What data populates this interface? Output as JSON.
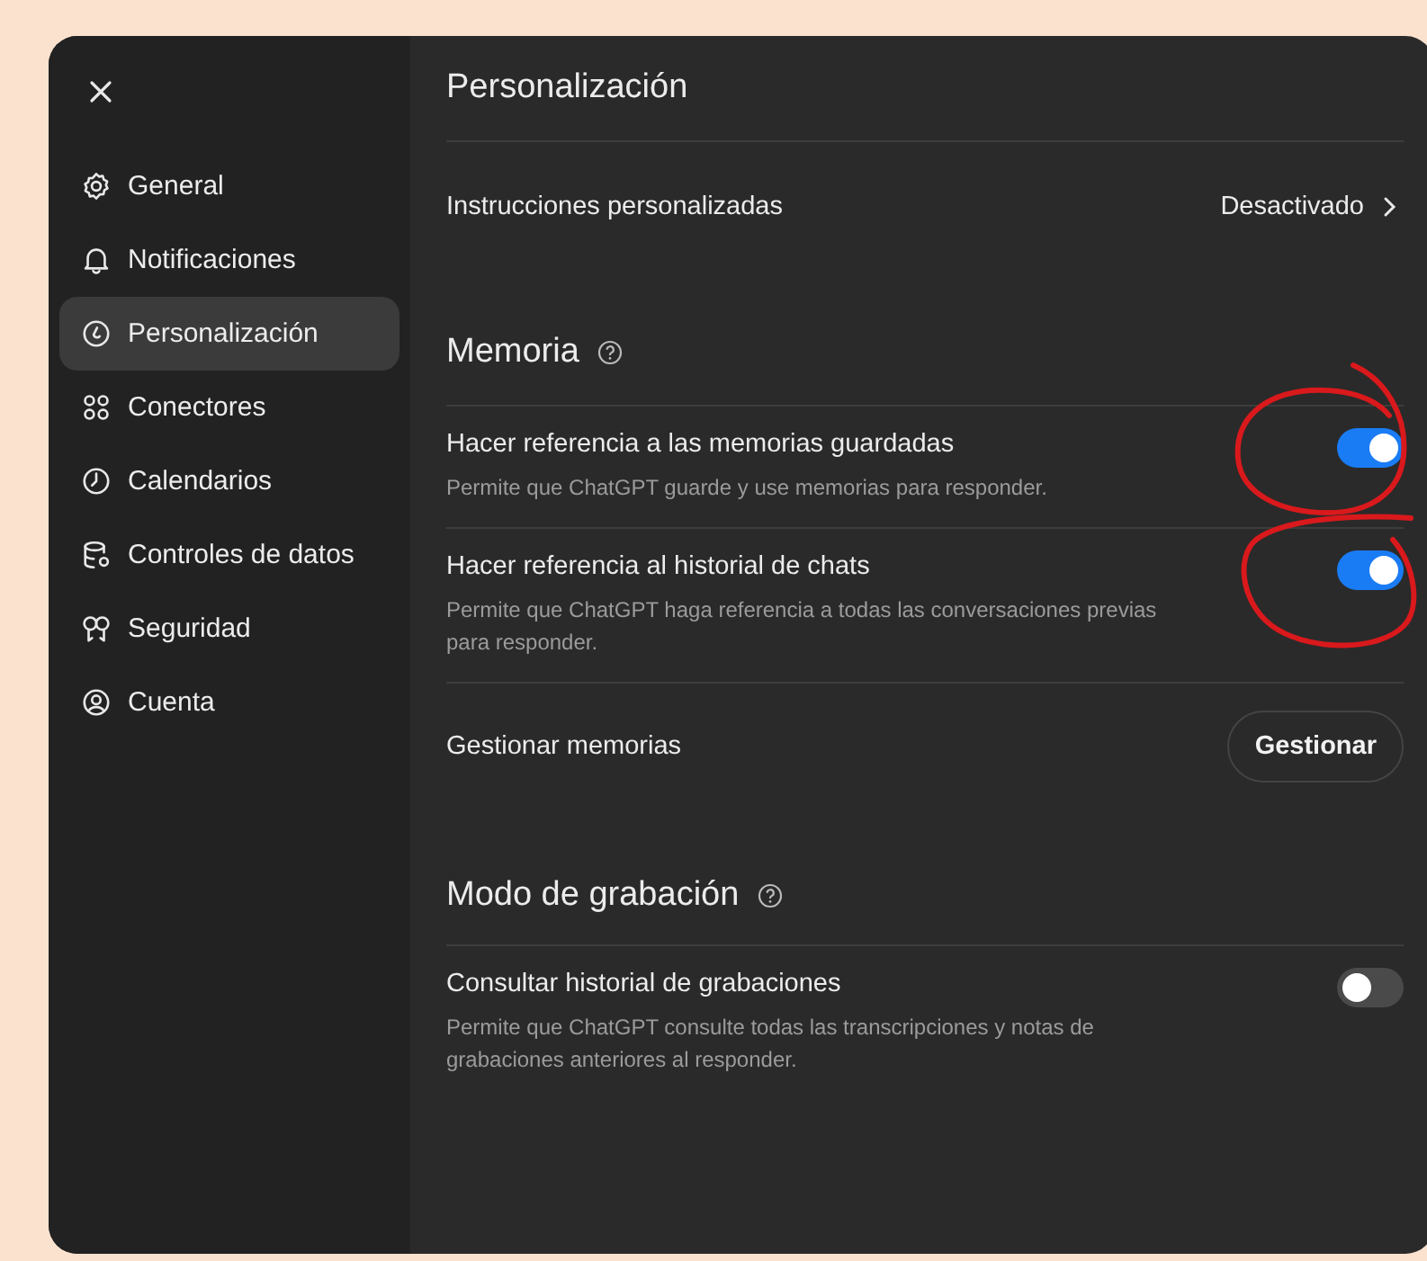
{
  "sidebar": {
    "items": [
      {
        "label": "General",
        "selected": false
      },
      {
        "label": "Notificaciones",
        "selected": false
      },
      {
        "label": "Personalización",
        "selected": true
      },
      {
        "label": "Conectores",
        "selected": false
      },
      {
        "label": "Calendarios",
        "selected": false
      },
      {
        "label": "Controles de datos",
        "selected": false
      },
      {
        "label": "Seguridad",
        "selected": false
      },
      {
        "label": "Cuenta",
        "selected": false
      }
    ]
  },
  "page": {
    "title": "Personalización",
    "rows": [
      {
        "kind": "link",
        "label": "Instrucciones personalizadas",
        "value": "Desactivado"
      }
    ]
  },
  "sections": [
    {
      "title": "Memoria",
      "help": true,
      "rows": [
        {
          "kind": "toggle",
          "label": "Hacer referencia a las memorias guardadas",
          "description": "Permite que ChatGPT guarde y use memorias para responder.",
          "on": true
        },
        {
          "kind": "toggle",
          "label": "Hacer referencia al historial de chats",
          "description": "Permite que ChatGPT haga referencia a todas las conversaciones previas para responder.",
          "on": true
        },
        {
          "kind": "button",
          "label": "Gestionar memorias",
          "button": "Gestionar"
        }
      ]
    },
    {
      "title": "Modo de grabación",
      "help": true,
      "rows": [
        {
          "kind": "toggle",
          "label": "Consultar historial de grabaciones",
          "description": "Permite que ChatGPT consulte todas las transcripciones y notas de grabaciones anteriores al responder.",
          "on": false
        }
      ]
    }
  ]
}
